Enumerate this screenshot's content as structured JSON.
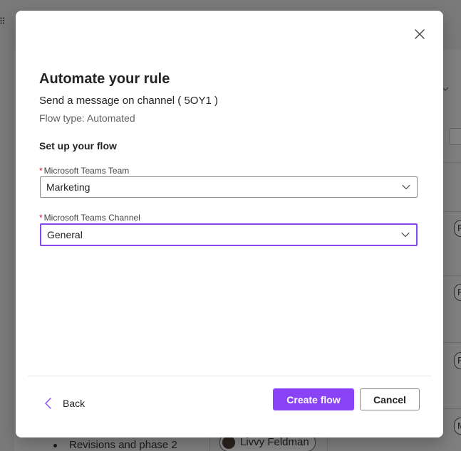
{
  "background": {
    "list_item_text": "Revisions and phase 2",
    "person_name": "Livvy Feldman",
    "side_initials": [
      "R",
      "R",
      "R",
      "M"
    ]
  },
  "dialog": {
    "title": "Automate your rule",
    "subtitle": "Send a message on channel ( 5OY1 )",
    "flow_type": "Flow type: Automated",
    "section_heading": "Set up your flow",
    "fields": [
      {
        "label": "Microsoft Teams Team",
        "required_marker": "*",
        "value": "Marketing"
      },
      {
        "label": "Microsoft Teams Channel",
        "required_marker": "*",
        "value": "General"
      }
    ],
    "footer": {
      "back_label": "Back",
      "create_label": "Create flow",
      "cancel_label": "Cancel"
    }
  },
  "colors": {
    "accent": "#8942f5",
    "focus_border": "#8a47f0",
    "required": "#c50f1f",
    "overlay": "#7a7a7a"
  },
  "icons": {
    "close": "close-icon",
    "dropdown": "chevron-down-icon",
    "back": "chevron-left-icon",
    "grip": "grip-icon"
  }
}
